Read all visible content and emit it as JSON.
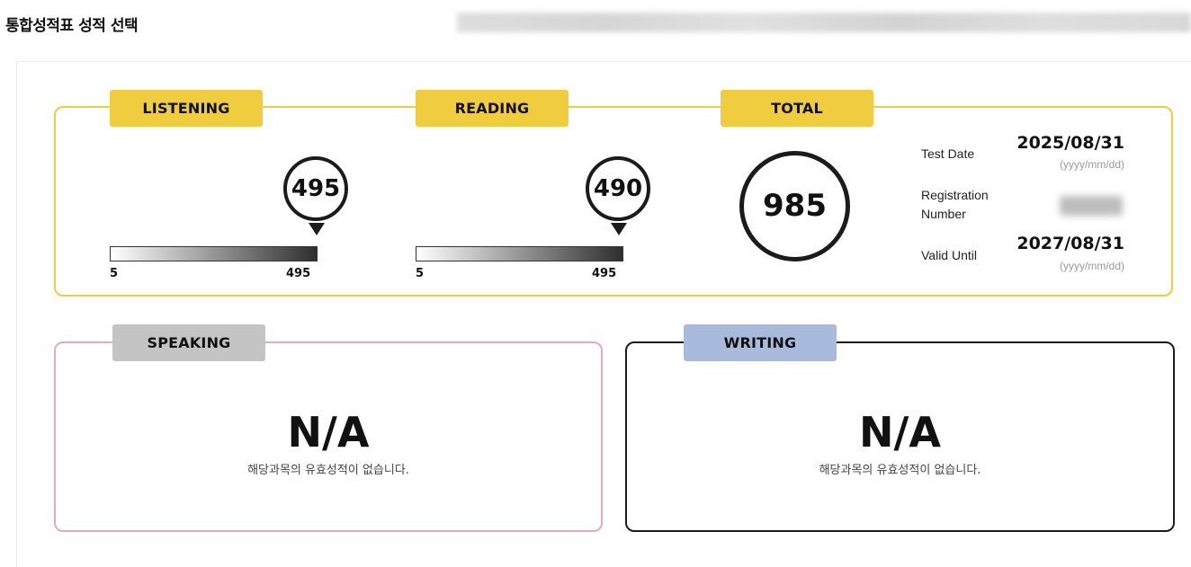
{
  "page": {
    "title": "통합성적표 성적 선택"
  },
  "listening": {
    "tab_label": "LISTENING",
    "score": "495",
    "score_value": 495,
    "scale_min": "5",
    "scale_max": "495"
  },
  "reading": {
    "tab_label": "READING",
    "score": "490",
    "score_value": 490,
    "scale_min": "5",
    "scale_max": "495"
  },
  "total": {
    "tab_label": "TOTAL",
    "score": "985"
  },
  "details": {
    "test_date_label": "Test Date",
    "test_date": "2025/08/31",
    "test_date_format": "(yyyy/mm/dd)",
    "registration_label_line1": "Registration",
    "registration_label_line2": "Number",
    "valid_until_label": "Valid Until",
    "valid_until": "2027/08/31",
    "valid_until_format": "(yyyy/mm/dd)"
  },
  "speaking": {
    "tab_label": "SPEAKING",
    "score": "N/A",
    "message": "해당과목의 유효성적이 없습니다."
  },
  "writing": {
    "tab_label": "WRITING",
    "score": "N/A",
    "message": "해당과목의 유효성적이 없습니다."
  },
  "colors": {
    "accent_yellow": "#f0cc3f",
    "speaking_tab": "#c4c4c4",
    "speaking_border": "#e8a9bd",
    "writing_tab": "#a9bbdc",
    "writing_border": "#1b1b1b"
  }
}
